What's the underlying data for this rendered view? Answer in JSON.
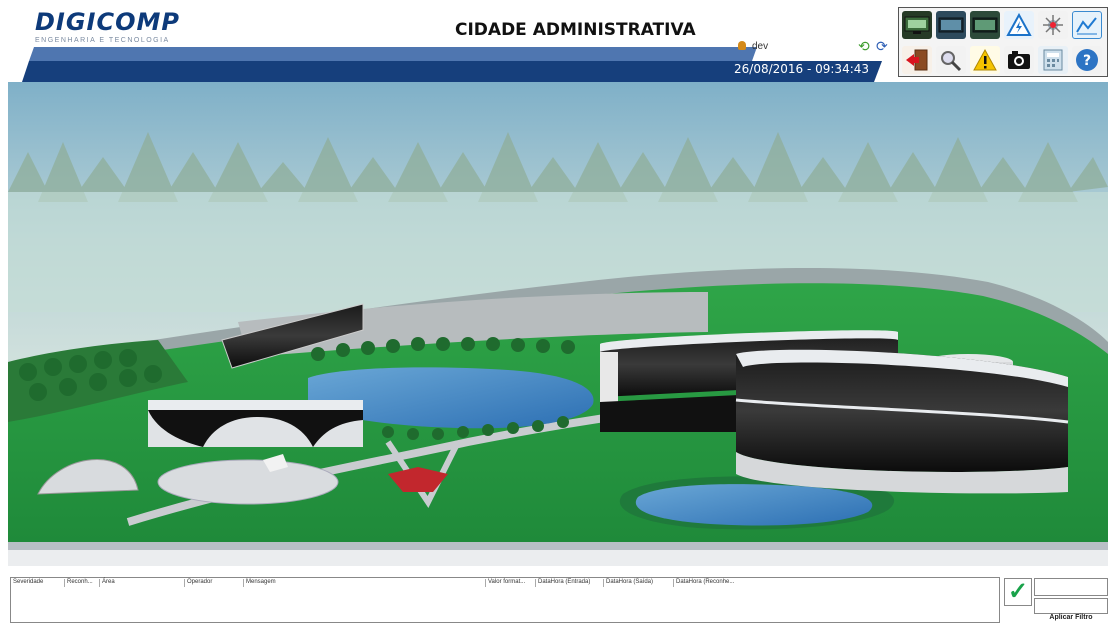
{
  "header": {
    "logo": "DIGICOMP",
    "logo_sub": "ENGENHARIA E TECNOLOGIA",
    "title": "CIDADE ADMINISTRATIVA",
    "user": "dev",
    "datetime": "26/08/2016 - 09:34:43"
  },
  "toolbar": {
    "icons": [
      "monitor-icon",
      "display-icon",
      "display-dark-icon",
      "electrical-warning-icon",
      "network-icon",
      "chart-icon",
      "exit-door-icon",
      "search-icon",
      "alert-icon",
      "camera-icon",
      "calculator-icon",
      "help-icon"
    ]
  },
  "alarm_table": {
    "columns": [
      "Severidade",
      "Reconh...",
      "Área",
      "Operador",
      "Mensagem",
      "Valor format...",
      "DataHora (Entrada)",
      "DataHora (Saída)",
      "DataHora (Reconhe..."
    ],
    "apply_filter": "Aplicar Filtro"
  },
  "colors": {
    "brand_blue": "#0d3a7a",
    "bar_blue": "#163f7c",
    "grass": "#2a9a44"
  }
}
